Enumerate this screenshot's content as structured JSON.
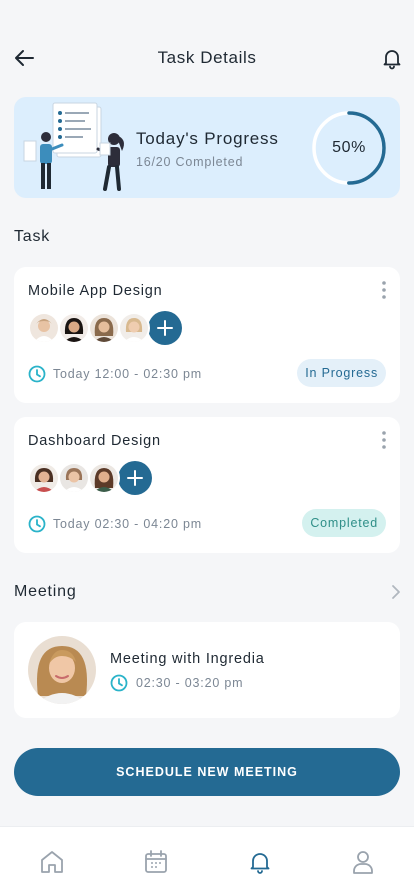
{
  "header": {
    "title": "Task Details",
    "back_icon": "arrow-left-icon",
    "bell_icon": "bell-icon"
  },
  "progress": {
    "title": "Today's Progress",
    "subtitle": "16/20 Completed",
    "percent_label": "50%",
    "percent_value": 0.5,
    "illustration": "people-with-checklist-illustration"
  },
  "tasks_section": {
    "title": "Task",
    "items": [
      {
        "name": "Mobile App Design",
        "time": "Today 12:00 - 02:30 pm",
        "status": "In Progress",
        "assignees": 4
      },
      {
        "name": "Dashboard Design",
        "time": "Today 02:30 - 04:20 pm",
        "status": "Completed",
        "assignees": 3
      }
    ]
  },
  "meeting_section": {
    "title": "Meeting",
    "meeting": {
      "title": "Meeting with Ingredia",
      "time": "02:30 - 03:20 pm"
    }
  },
  "cta": {
    "label": "SCHEDULE NEW MEETING"
  },
  "tabbar": {
    "items": [
      "home-icon",
      "calendar-icon",
      "bell-icon",
      "user-icon"
    ],
    "active": "bell-icon"
  },
  "colors": {
    "primary": "#246a93",
    "accent_teal": "#2ab3c9",
    "progress_bg": "#dceefd",
    "status_in_progress_bg": "#e4f0f9",
    "status_completed_bg": "#d4f1ef",
    "page_bg": "#f5f6f8"
  }
}
